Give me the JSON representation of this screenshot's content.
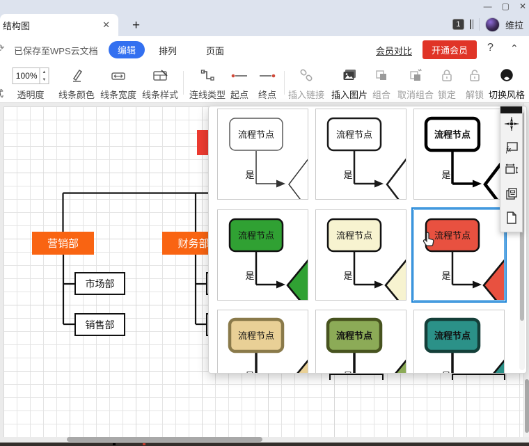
{
  "window": {
    "minimize": "—",
    "maximize": "▢",
    "close": "✕"
  },
  "tabbar": {
    "doc_tab": "结构图",
    "tab_close": "✕",
    "new_tab": "+",
    "doc_count_badge": "1",
    "user_name": "维拉"
  },
  "menubar": {
    "save_status": "已保存至WPS云文档",
    "edit": "编辑",
    "arrange": "排列",
    "page": "页面",
    "member_compare": "会员对比",
    "upgrade": "开通会员",
    "help": "?",
    "collapse": "⌃"
  },
  "toolbar": {
    "clipped_label": "式",
    "zoom_value": "100%",
    "transparency": "透明度",
    "line_color": "线条颜色",
    "line_width": "线条宽度",
    "line_style": "线条样式",
    "connector_type": "连线类型",
    "start_point": "起点",
    "end_point": "终点",
    "insert_link": "插入链接",
    "insert_image": "插入图片",
    "group": "组合",
    "ungroup": "取消组合",
    "lock": "锁定",
    "unlock": "解锁",
    "switch_style": "切换风格"
  },
  "canvas": {
    "marketing_dept": "营销部",
    "finance_dept": "财务部",
    "market_dept": "市场部",
    "sales_dept": "销售部",
    "accent_orange": "#f96412",
    "accent_red": "#ed3b31",
    "line_color": "#111111"
  },
  "style_panel": {
    "node_label": "流程节点",
    "yes_label": "是",
    "selection_color": "#1f86d8",
    "cells": [
      {
        "name": "white-thin",
        "fill": "#ffffff",
        "stroke": "#595959",
        "line": "#333333",
        "weight": 1.5,
        "bold": false,
        "selected": false,
        "tri_fill": "none"
      },
      {
        "name": "white-medium",
        "fill": "#ffffff",
        "stroke": "#1a1a1a",
        "line": "#1a1a1a",
        "weight": 2.5,
        "bold": false,
        "selected": false,
        "tri_fill": "none"
      },
      {
        "name": "white-bold",
        "fill": "#ffffff",
        "stroke": "#000000",
        "line": "#000000",
        "weight": 4.5,
        "bold": true,
        "selected": false,
        "tri_fill": "none"
      },
      {
        "name": "green",
        "fill": "#30a133",
        "stroke": "#111111",
        "line": "#111111",
        "weight": 2.5,
        "bold": false,
        "selected": false,
        "tri_fill": "#30a133"
      },
      {
        "name": "cream",
        "fill": "#f7f3d0",
        "stroke": "#111111",
        "line": "#111111",
        "weight": 2.5,
        "bold": false,
        "selected": false,
        "tri_fill": "#f7f3d0"
      },
      {
        "name": "red",
        "fill": "#e85140",
        "stroke": "#111111",
        "line": "#111111",
        "weight": 2.5,
        "bold": false,
        "selected": true,
        "tri_fill": "#e85140"
      },
      {
        "name": "tan",
        "fill": "#e9d096",
        "stroke": "#8a7a4a",
        "line": "#1a1a1a",
        "weight": 4.5,
        "bold": false,
        "selected": false,
        "tri_fill": "#e9d096"
      },
      {
        "name": "olive",
        "fill": "#8cab57",
        "stroke": "#47531f",
        "line": "#111111",
        "weight": 4.5,
        "bold": true,
        "selected": false,
        "tri_fill": "#8cab57"
      },
      {
        "name": "teal",
        "fill": "#2b9188",
        "stroke": "#143f39",
        "line": "#111111",
        "weight": 4.5,
        "bold": true,
        "selected": false,
        "tri_fill": "#2b9188"
      }
    ]
  }
}
